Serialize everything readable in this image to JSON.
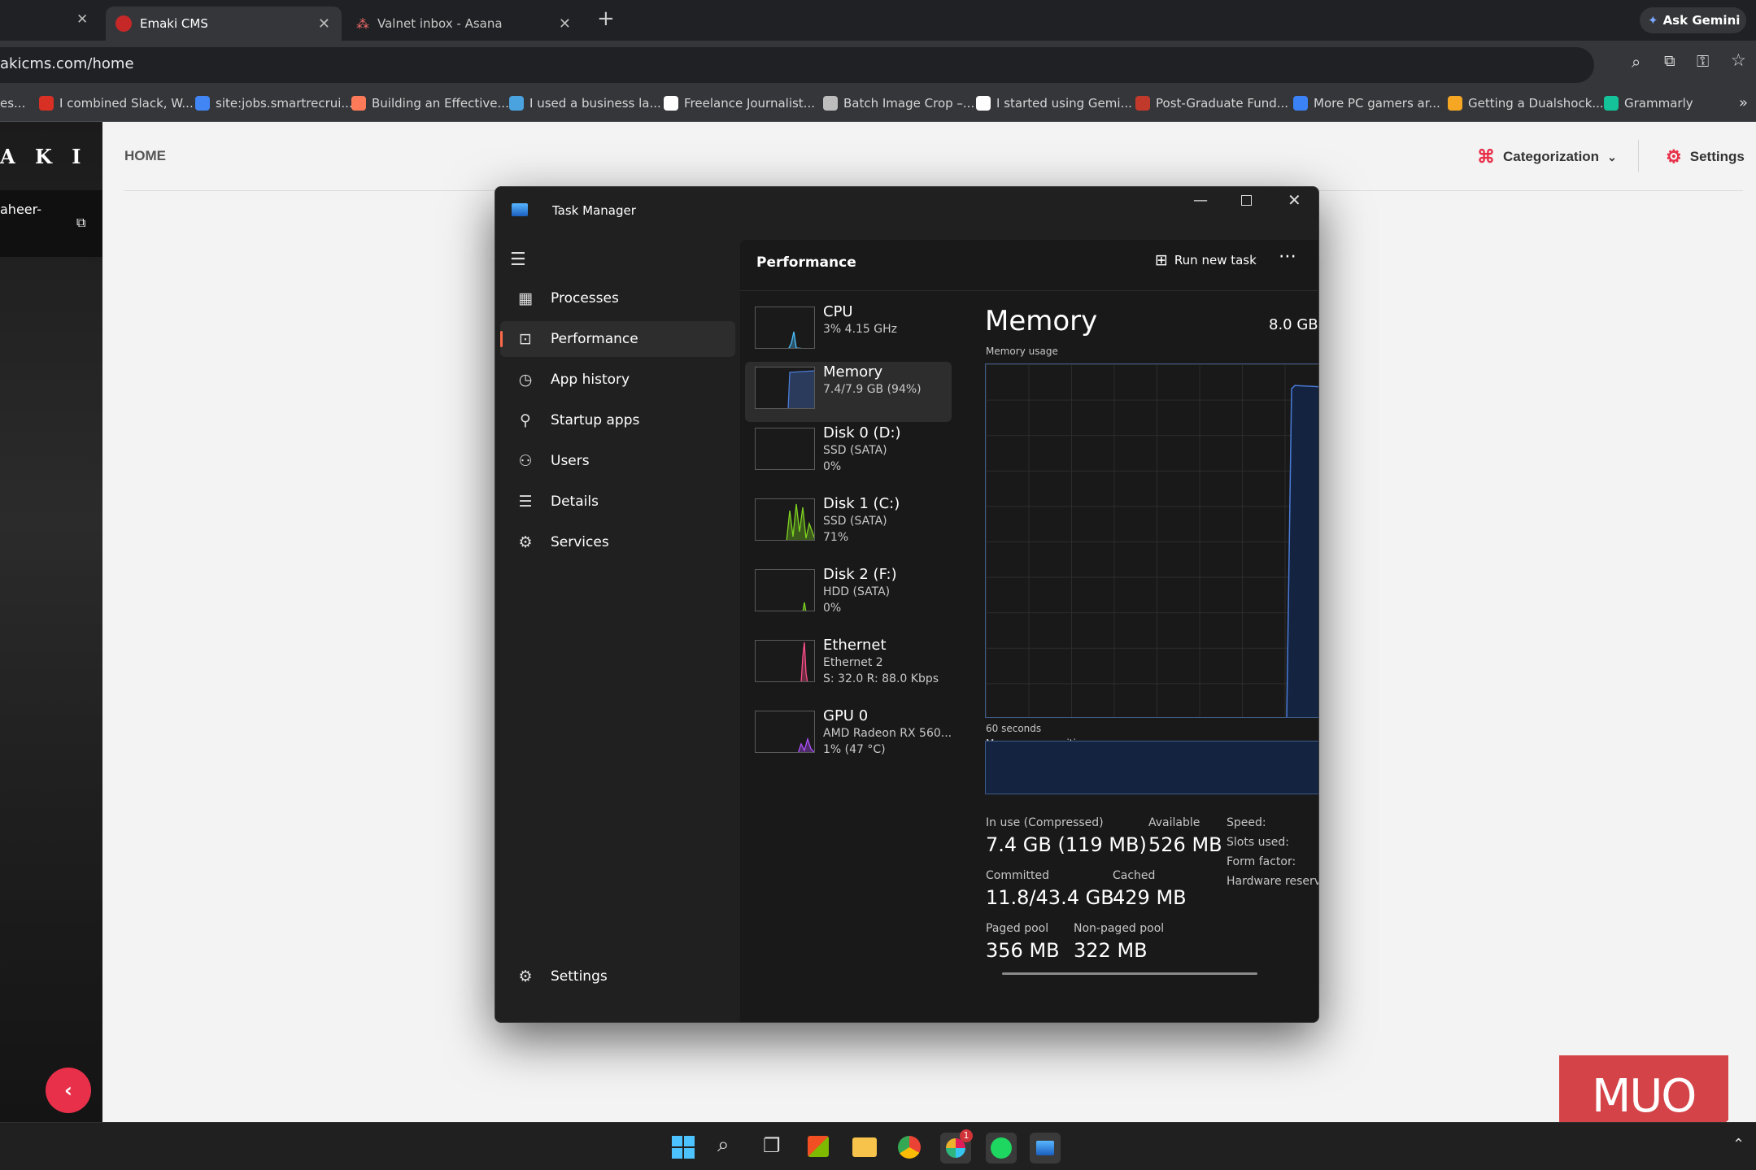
{
  "browser": {
    "tabs": [
      {
        "title": "Emaki CMS",
        "active": true
      },
      {
        "title": "Valnet inbox - Asana",
        "active": false
      }
    ],
    "new_tab": "+",
    "close_glyph": "✕",
    "ask_gemini": "Ask Gemini",
    "url": "akicms.com/home",
    "bookmarks": [
      "es...",
      "I combined Slack, W...",
      "site:jobs.smartrecrui...",
      "Building an Effective...",
      "I used a business la...",
      "Freelance Journalist...",
      "Batch Image Crop –...",
      "I started using Gemi...",
      "Post-Graduate Fund...",
      "More PC gamers ar...",
      "Getting a Dualshock...",
      "Grammarly"
    ],
    "bookmark_colors": [
      "#888",
      "#d93025",
      "#4285f4",
      "#ff7a59",
      "#4aa3df",
      "#ffffff",
      "#bdbdbd",
      "#ffffff",
      "#c0392b",
      "#3b82f6",
      "#f5a623",
      "#15c39a"
    ]
  },
  "cms": {
    "logo_text": "A K I",
    "user_text": "aheer-",
    "home_label": "HOME",
    "categorization_label": "Categorization",
    "settings_label": "Settings",
    "accent": "#e8304a"
  },
  "task_manager": {
    "title": "Task Manager",
    "nav": [
      {
        "label": "Processes",
        "icon": "processes-icon",
        "glyph": "▦",
        "selected": false
      },
      {
        "label": "Performance",
        "icon": "performance-icon",
        "glyph": "⊡",
        "selected": true
      },
      {
        "label": "App history",
        "icon": "app-history-icon",
        "glyph": "◷",
        "selected": false
      },
      {
        "label": "Startup apps",
        "icon": "startup-apps-icon",
        "glyph": "⚲",
        "selected": false
      },
      {
        "label": "Users",
        "icon": "users-icon",
        "glyph": "⚇",
        "selected": false
      },
      {
        "label": "Details",
        "icon": "details-icon",
        "glyph": "☰",
        "selected": false
      },
      {
        "label": "Services",
        "icon": "services-icon",
        "glyph": "⚙",
        "selected": false
      }
    ],
    "settings_label": "Settings",
    "section_title": "Performance",
    "run_new_task": "Run new task",
    "devices": [
      {
        "name": "CPU",
        "line1": "3% 4.15 GHz",
        "line2": "",
        "color": "#4cc2ff",
        "selected": false
      },
      {
        "name": "Memory",
        "line1": "7.4/7.9 GB (94%)",
        "line2": "",
        "color": "#4a7bd8",
        "selected": true
      },
      {
        "name": "Disk 0 (D:)",
        "line1": "SSD (SATA)",
        "line2": "0%",
        "color": "#7ed321",
        "selected": false
      },
      {
        "name": "Disk 1 (C:)",
        "line1": "SSD (SATA)",
        "line2": "71%",
        "color": "#7ed321",
        "selected": false
      },
      {
        "name": "Disk 2 (F:)",
        "line1": "HDD (SATA)",
        "line2": "0%",
        "color": "#7ed321",
        "selected": false
      },
      {
        "name": "Ethernet",
        "line1": "Ethernet 2",
        "line2": "S: 32.0 R: 88.0 Kbps",
        "color": "#ff4f8b",
        "selected": false
      },
      {
        "name": "GPU 0",
        "line1": "AMD Radeon RX 560...",
        "line2": "1% (47 °C)",
        "color": "#b04fff",
        "selected": false
      }
    ],
    "memory": {
      "heading": "Memory",
      "total": "8.0 GB",
      "usage_label": "Memory usage",
      "seconds_label": "60 seconds",
      "composition_label": "Memory composition",
      "usage_fraction": 0.94,
      "in_use_label": "In use (Compressed)",
      "in_use_value": "7.4 GB (119 MB)",
      "available_label": "Available",
      "available_value": "526 MB",
      "committed_label": "Committed",
      "committed_value": "11.8/43.4 GB",
      "cached_label": "Cached",
      "cached_value": "429 MB",
      "paged_label": "Paged pool",
      "paged_value": "356 MB",
      "nonpaged_label": "Non-paged pool",
      "nonpaged_value": "322 MB",
      "speed_label": "Speed:",
      "slots_label": "Slots used:",
      "form_label": "Form factor:",
      "hw_label": "Hardware reserved"
    }
  },
  "watermark": "MUO",
  "taskbar_icons": [
    "windows-start-icon",
    "search-icon",
    "task-view-icon",
    "store-icon",
    "file-explorer-icon",
    "chrome-icon",
    "slack-icon",
    "spotify-icon",
    "task-manager-icon"
  ],
  "slack_badge": "1"
}
